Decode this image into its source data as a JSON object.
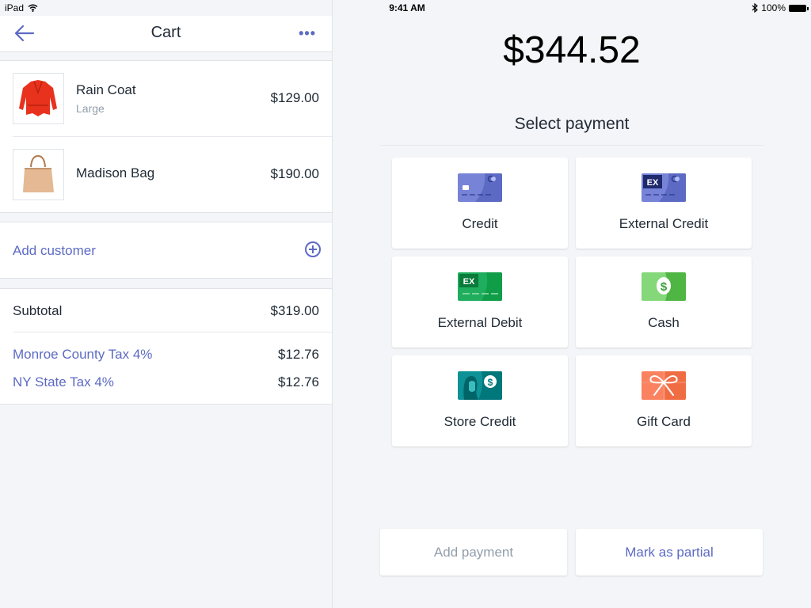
{
  "status_bar": {
    "device": "iPad",
    "time": "9:41 AM",
    "battery": "100%",
    "icons": [
      "wifi-icon",
      "bluetooth-icon",
      "battery-icon"
    ]
  },
  "cart": {
    "title": "Cart",
    "back_icon": "arrow-left-icon",
    "more_icon": "more-horizontal-icon",
    "more_label": "•••",
    "items": [
      {
        "name": "Rain Coat",
        "variant": "Large",
        "price": "$129.00",
        "image": "red-rain-coat"
      },
      {
        "name": "Madison Bag",
        "variant": "",
        "price": "$190.00",
        "image": "tan-tote-bag"
      }
    ],
    "add_customer": "Add customer",
    "subtotal": {
      "label": "Subtotal",
      "value": "$319.00"
    },
    "taxes": [
      {
        "label": "Monroe County Tax 4%",
        "value": "$12.76"
      },
      {
        "label": "NY State Tax 4%",
        "value": "$12.76"
      }
    ]
  },
  "payment": {
    "total": "$344.52",
    "select_label": "Select payment",
    "methods": [
      {
        "label": "Credit",
        "icon": "credit-card-icon",
        "color": "#5c6ac4"
      },
      {
        "label": "External Credit",
        "icon": "external-credit-card-icon",
        "color": "#5c6ac4"
      },
      {
        "label": "External Debit",
        "icon": "external-debit-card-icon",
        "color": "#0f9d58"
      },
      {
        "label": "Cash",
        "icon": "cash-icon",
        "color": "#50b83c"
      },
      {
        "label": "Store Credit",
        "icon": "store-credit-icon",
        "color": "#007a7c"
      },
      {
        "label": "Gift Card",
        "icon": "gift-card-icon",
        "color": "#f06d44"
      }
    ],
    "add_payment": "Add payment",
    "mark_partial": "Mark as partial"
  },
  "colors": {
    "accent": "#5c6ac4",
    "text": "#212b36",
    "muted": "#919eab",
    "background": "#f4f5f8"
  }
}
